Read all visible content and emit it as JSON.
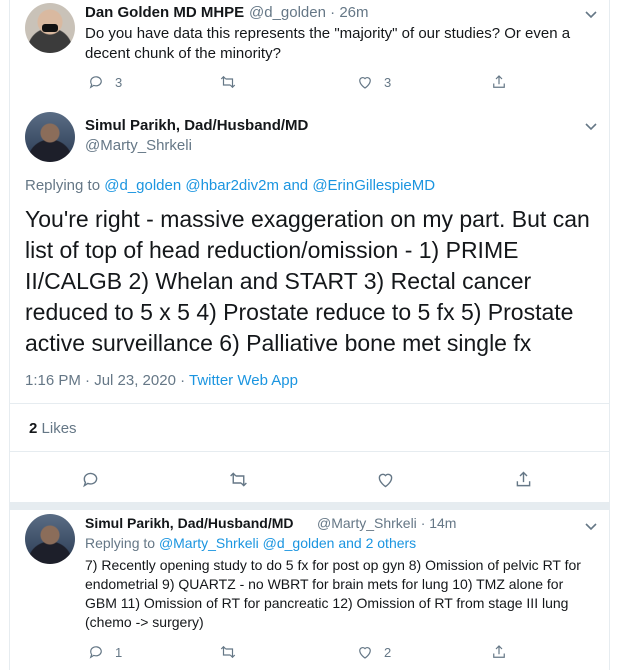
{
  "tweet1": {
    "name": "Dan Golden MD MHPE",
    "handle": "@d_golden",
    "time": "26m",
    "text": "Do you have data this represents the \"majority\" of our studies? Or even a decent chunk of the minority?",
    "replies": "3",
    "likes": "3"
  },
  "main": {
    "name": "Simul Parikh, Dad/Husband/MD",
    "handle": "@Marty_Shrkeli",
    "replying_prefix": "Replying to",
    "replying_links": "@d_golden @hbar2div2m",
    "replying_and": "and",
    "replying_last": "@ErinGillespieMD",
    "text": "You're right - massive exaggeration on my part. But can list of top of head reduction/omission - 1) PRIME II/CALGB 2) Whelan and START 3) Rectal cancer reduced to 5 x 5 4) Prostate reduce to 5 fx 5) Prostate active surveillance 6) Palliative bone met single fx",
    "timestamp": "1:16 PM · Jul 23, 2020 ·",
    "source": "Twitter Web App",
    "likes_count": "2",
    "likes_label": "Likes"
  },
  "tweet3": {
    "name": "Simul Parikh, Dad/Husband/MD",
    "handle": "@Marty_Shrkeli",
    "time": "· 14m",
    "replying_prefix": "Replying to",
    "replying_links": "@Marty_Shrkeli @d_golden",
    "replying_others": "and 2 others",
    "text": "7) Recently opening study to do 5 fx for post op gyn 8) Omission of pelvic RT for endometrial 9) QUARTZ - no WBRT for brain mets for lung 10) TMZ alone for GBM 11) Omission of RT for pancreatic 12) Omission of RT from stage III lung (chemo -> surgery)",
    "replies": "1",
    "likes": "2"
  },
  "icons": [
    "reply-icon",
    "retweet-icon",
    "like-icon",
    "share-icon",
    "chevron-down-icon"
  ],
  "colors": {
    "link": "#1b95e0",
    "muted": "#657786",
    "text": "#14171a",
    "border": "#e6ecf0"
  }
}
